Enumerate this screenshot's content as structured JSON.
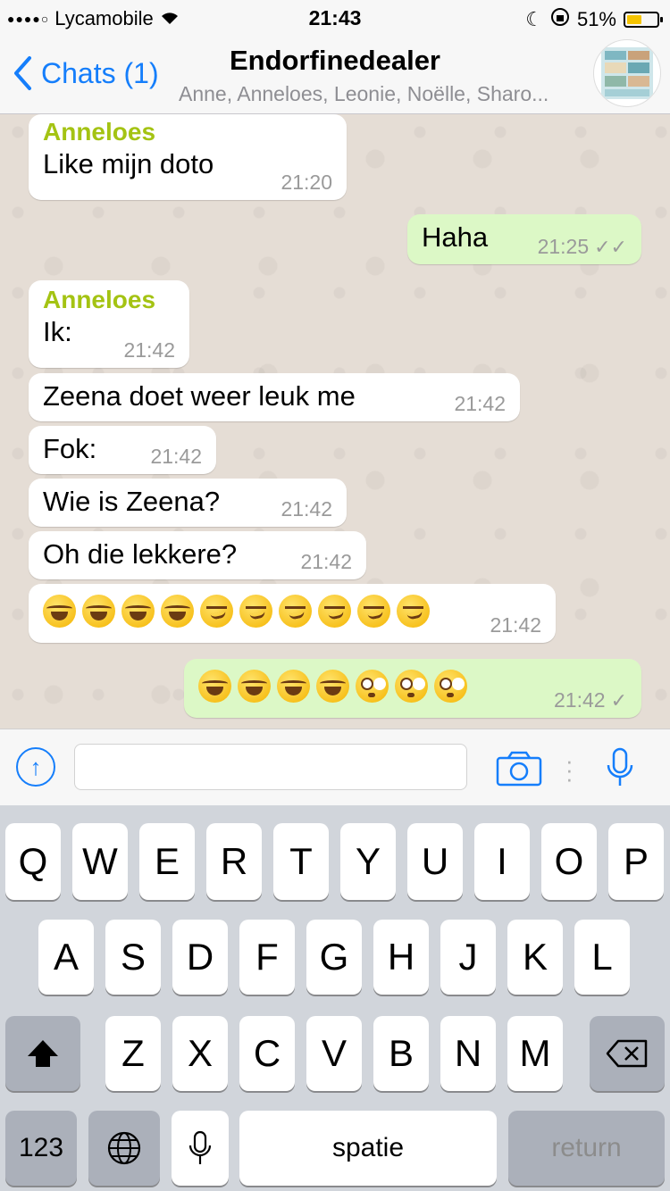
{
  "status_bar": {
    "carrier": "Lycamobile",
    "time": "21:43",
    "battery_percent": "51%",
    "battery_level": 0.51
  },
  "nav": {
    "back_label": "Chats (1)",
    "title": "Endorfinedealer",
    "subtitle": "Anne, Anneloes, Leonie, Noëlle, Sharo..."
  },
  "messages": [
    {
      "direction": "in",
      "sender": "Anneloes",
      "text": "Like mijn doto",
      "time": "21:20"
    },
    {
      "direction": "out",
      "text": "Haha",
      "time": "21:25",
      "status": "read"
    },
    {
      "direction": "in",
      "sender": "Anneloes",
      "text": "Ik:",
      "time": "21:42"
    },
    {
      "direction": "in",
      "text": "Zeena doet weer leuk me",
      "time": "21:42"
    },
    {
      "direction": "in",
      "text": "Fok:",
      "time": "21:42"
    },
    {
      "direction": "in",
      "text": "Wie is Zeena?",
      "time": "21:42"
    },
    {
      "direction": "in",
      "text": "Oh die lekkere?",
      "time": "21:42"
    },
    {
      "direction": "in",
      "emojis": [
        "face-with-tears-of-joy",
        "face-with-tears-of-joy",
        "face-with-tears-of-joy",
        "face-with-tears-of-joy",
        "smirking-face",
        "smirking-face",
        "smirking-face",
        "smirking-face",
        "smirking-face",
        "smirking-face"
      ],
      "time": "21:42"
    },
    {
      "direction": "out",
      "emojis": [
        "face-with-tears-of-joy",
        "face-with-tears-of-joy",
        "face-with-tears-of-joy",
        "face-with-tears-of-joy",
        "flushed-face",
        "flushed-face",
        "flushed-face"
      ],
      "time": "21:42",
      "status": "sent"
    }
  ],
  "input": {
    "value": "",
    "placeholder": ""
  },
  "keyboard": {
    "row1": [
      "Q",
      "W",
      "E",
      "R",
      "T",
      "Y",
      "U",
      "I",
      "O",
      "P"
    ],
    "row2": [
      "A",
      "S",
      "D",
      "F",
      "G",
      "H",
      "J",
      "K",
      "L"
    ],
    "row3": [
      "Z",
      "X",
      "C",
      "V",
      "B",
      "N",
      "M"
    ],
    "numbers_label": "123",
    "space_label": "spatie",
    "return_label": "return"
  },
  "colors": {
    "accent": "#157efb",
    "sender_name": "#a4c313",
    "outgoing_bubble": "#dcf8c6",
    "incoming_bubble": "#ffffff"
  }
}
